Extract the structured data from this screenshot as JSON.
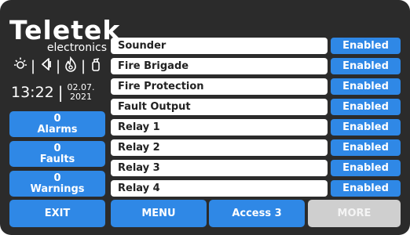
{
  "logo": {
    "brand": "Teletek",
    "sub": "electronics"
  },
  "status_icons": [
    {
      "name": "sun-icon",
      "glyph": "☼"
    },
    {
      "name": "speaker-icon",
      "glyph": "◁"
    },
    {
      "name": "flame-icon",
      "glyph": "♨"
    },
    {
      "name": "extinguisher-icon",
      "glyph": "⛫"
    }
  ],
  "clock": {
    "time": "13:22",
    "date_line1": "02.07.",
    "date_line2": "2021"
  },
  "side_buttons": {
    "alarms": {
      "count": "0",
      "label": "Alarms"
    },
    "faults": {
      "count": "0",
      "label": "Faults"
    },
    "warnings": {
      "count": "0",
      "label": "Warnings"
    }
  },
  "outputs": [
    {
      "name": "Sounder",
      "status": "Enabled"
    },
    {
      "name": "Fire Brigade",
      "status": "Enabled"
    },
    {
      "name": "Fire Protection",
      "status": "Enabled"
    },
    {
      "name": "Fault Output",
      "status": "Enabled"
    },
    {
      "name": "Relay 1",
      "status": "Enabled"
    },
    {
      "name": "Relay 2",
      "status": "Enabled"
    },
    {
      "name": "Relay 3",
      "status": "Enabled"
    },
    {
      "name": "Relay 4",
      "status": "Enabled"
    }
  ],
  "bottom_bar": {
    "exit": "EXIT",
    "menu": "MENU",
    "access": "Access 3",
    "more": "MORE"
  },
  "colors": {
    "panel_bg": "#2b2b2b",
    "accent_blue": "#2f88e6",
    "disabled_gray": "#cfcfcf"
  }
}
